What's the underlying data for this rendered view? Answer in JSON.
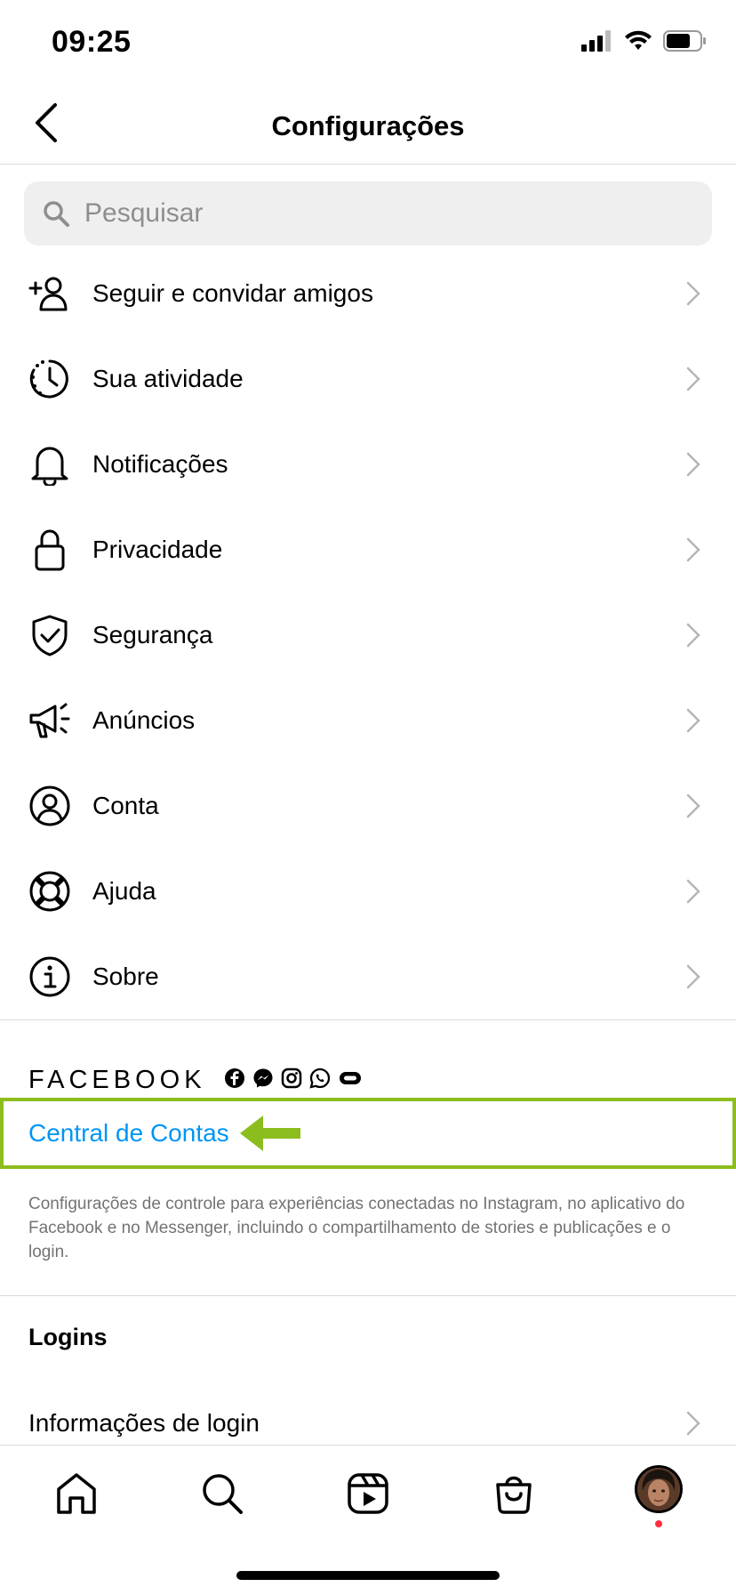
{
  "status_bar": {
    "time": "09:25"
  },
  "header": {
    "title": "Configurações"
  },
  "search": {
    "placeholder": "Pesquisar"
  },
  "menu_items": [
    {
      "label": "Seguir e convidar amigos",
      "icon": "follow-invite-icon"
    },
    {
      "label": "Sua atividade",
      "icon": "activity-icon"
    },
    {
      "label": "Notificações",
      "icon": "bell-icon"
    },
    {
      "label": "Privacidade",
      "icon": "lock-icon"
    },
    {
      "label": "Segurança",
      "icon": "shield-icon"
    },
    {
      "label": "Anúncios",
      "icon": "megaphone-icon"
    },
    {
      "label": "Conta",
      "icon": "account-icon"
    },
    {
      "label": "Ajuda",
      "icon": "lifebuoy-icon"
    },
    {
      "label": "Sobre",
      "icon": "info-icon"
    }
  ],
  "facebook_section": {
    "brand": "FACEBOOK",
    "accounts_center_label": "Central de Contas",
    "description": "Configurações de controle para experiências conectadas no Instagram, no aplicativo do Facebook e no Messenger, incluindo o compartilhamento de stories e publicações e o login."
  },
  "logins_section": {
    "title": "Logins",
    "login_info_label": "Informações de login"
  },
  "colors": {
    "link_blue": "#0095f6",
    "highlight_green": "#8cbd1e",
    "notification_red": "#ff3040",
    "muted_text": "#737373"
  }
}
